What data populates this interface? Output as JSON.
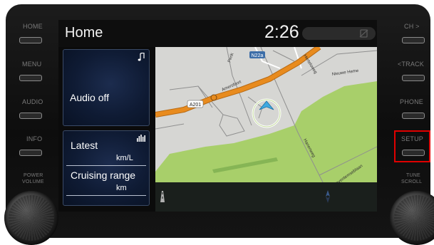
{
  "hardware": {
    "left_buttons": [
      {
        "id": "home",
        "label": "HOME"
      },
      {
        "id": "menu",
        "label": "MENU"
      },
      {
        "id": "audio",
        "label": "AUDIO"
      },
      {
        "id": "info",
        "label": "INFO"
      }
    ],
    "right_buttons": [
      {
        "id": "ch",
        "label": "CH >"
      },
      {
        "id": "track",
        "label": "<TRACK"
      },
      {
        "id": "phone",
        "label": "PHONE"
      },
      {
        "id": "setup",
        "label": "SETUP"
      }
    ],
    "power_volume": [
      "POWER",
      "VOLUME"
    ],
    "tune_scroll": [
      "TUNE",
      "SCROLL"
    ],
    "highlight_color": "#e00000"
  },
  "screen": {
    "title": "Home",
    "clock": "2:26"
  },
  "audio_tile": {
    "status": "Audio off",
    "icon": "music-note-icon"
  },
  "eco_tile": {
    "latest_label": "Latest",
    "latest_unit": "km/L",
    "range_label": "Cruising range",
    "range_unit": "km",
    "icon": "bar-graph-icon"
  },
  "map": {
    "road_labels": [
      "N22a",
      "A201",
      "Amersfoort",
      "Nieuwe Heme",
      "Zaventemseblaan",
      "Hanenweg",
      "Perik",
      "Herteloweg"
    ],
    "colors": {
      "park": "#a8cf6a",
      "land": "#d6d6d3",
      "major_road": "#e88b1e",
      "position_marker": "#3fa9e0"
    }
  }
}
